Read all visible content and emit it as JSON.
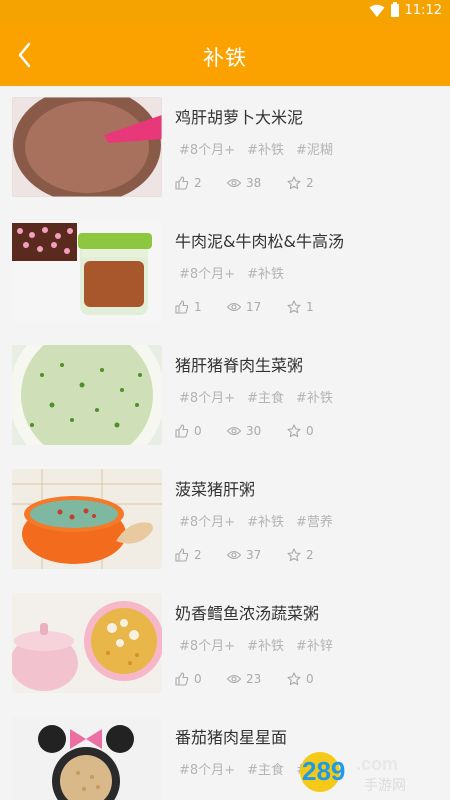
{
  "status": {
    "time": "11:12"
  },
  "header": {
    "title": "补铁"
  },
  "recipes": [
    {
      "name": "鸡肝胡萝卜大米泥",
      "tags": [
        "#8个月+",
        "#补铁",
        "#泥糊"
      ],
      "likes": "2",
      "views": "38",
      "favorites": "2"
    },
    {
      "name": "牛肉泥&牛肉松&牛高汤",
      "tags": [
        "#8个月+",
        "#补铁"
      ],
      "likes": "1",
      "views": "17",
      "favorites": "1"
    },
    {
      "name": "猪肝猪脊肉生菜粥",
      "tags": [
        "#8个月+",
        "#主食",
        "#补铁"
      ],
      "likes": "0",
      "views": "30",
      "favorites": "0"
    },
    {
      "name": "菠菜猪肝粥",
      "tags": [
        "#8个月+",
        "#补铁",
        "#营养"
      ],
      "likes": "2",
      "views": "37",
      "favorites": "2"
    },
    {
      "name": "奶香鳕鱼浓汤蔬菜粥",
      "tags": [
        "#8个月+",
        "#补铁",
        "#补锌"
      ],
      "likes": "0",
      "views": "23",
      "favorites": "0"
    },
    {
      "name": "番茄猪肉星星面",
      "tags": [
        "#8个月+",
        "#主食",
        "#补铁"
      ],
      "likes": "",
      "views": "",
      "favorites": ""
    }
  ],
  "watermark": {
    "text": "289",
    "domain": ".com",
    "site": "手游网"
  }
}
